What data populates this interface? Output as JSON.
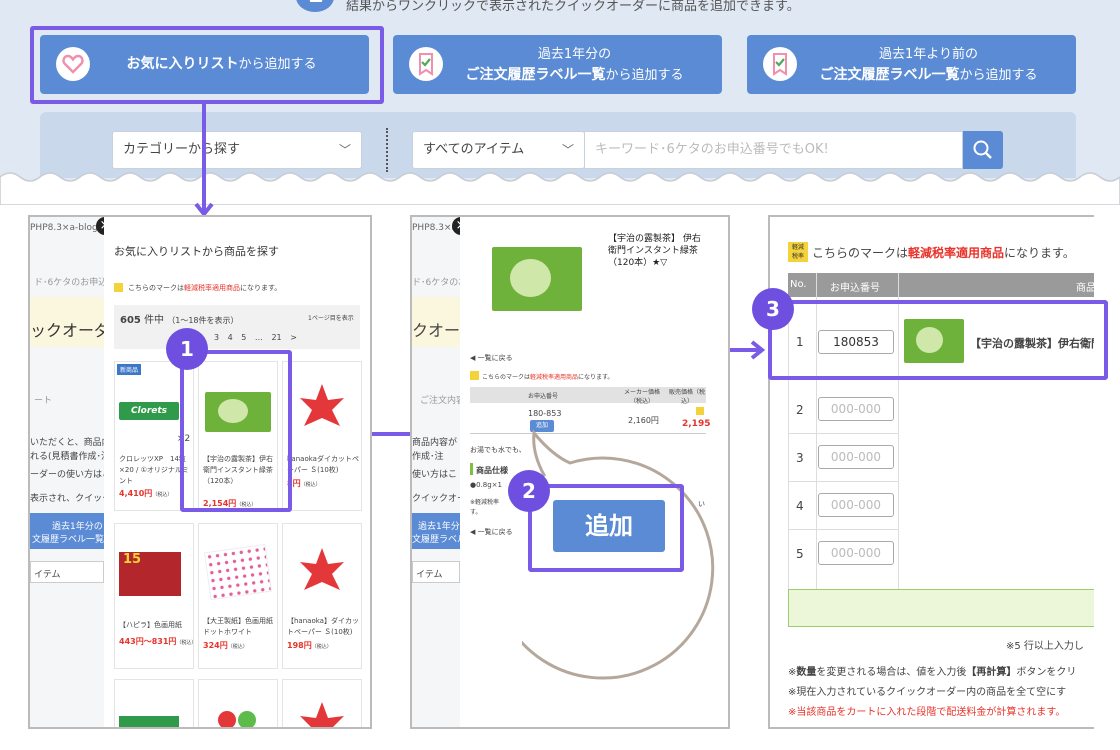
{
  "header": {
    "note": "結果からワンクリックで表示されたクイックオーダーに商品を追加できます。"
  },
  "buttons": [
    {
      "strong": "お気に入りリスト",
      "rest": "から追加する"
    },
    {
      "line1": "過去1年分の",
      "strong": "ご注文履歴ラベル一覧",
      "rest": "から追加する"
    },
    {
      "line1": "過去1年より前の",
      "strong": "ご注文履歴ラベル一覧",
      "rest": "から追加する"
    }
  ],
  "search": {
    "category": "カテゴリーから探す",
    "items": "すべてのアイテム",
    "placeholder": "キーワード･6ケタのお申込番号でもOK!"
  },
  "panel1": {
    "topbar": "PHP8.3×a-blog.",
    "title": "お気に入りリストから商品を探す",
    "tax_note_pre": "こちらのマークは",
    "tax_note_red": "軽減税率適用商品",
    "tax_note_post": "になります。",
    "count": "605",
    "count_unit": "件中",
    "range": "（1～18件を表示）",
    "per_page": "1ページ目を表示",
    "pages": [
      "3",
      "4",
      "5",
      "…",
      "21",
      ">"
    ],
    "bg": {
      "order": "ックオーダ",
      "l1": "ド･6ケタのお申込番号",
      "l2": "いただくと、商品内容が",
      "l3": "れる(見積書作成･注文",
      "l4": "ーダーの使い方はこち",
      "l5": "表示され、クイックオー",
      "btn1": "過去1年分の",
      "btn2": "文履歴ラベル一覧から",
      "sel": "イテム",
      "cart": "ート",
      "hist": "ご注文内容",
      "new": "新商品"
    },
    "products": [
      {
        "name": "クロレッツXP　14粒×20 / ①オリジナルミント",
        "price": "4,410円",
        "tax": "（税込）",
        "qty": "×2"
      },
      {
        "name": "【宇治の露製茶】伊右衛門インスタント緑茶（120本）",
        "price": "2,154円",
        "tax": "（税込）"
      },
      {
        "name": "hanaokaダイカットペーパー Ｓ(10枚)",
        "price": "8円",
        "tax": "（税込）"
      },
      {
        "name": "【ハピラ】色画用紙",
        "price": "443円～831円",
        "tax": "（税込）"
      },
      {
        "name": "【大王製紙】色画用紙 ドットホワイト",
        "price": "324円",
        "tax": "（税込）"
      },
      {
        "name": "【hanaoka】ダイカットペーパー Ｓ(10枚)",
        "price": "198円",
        "tax": "（税込）"
      }
    ],
    "logo": "Clorets",
    "box15": "15"
  },
  "panel2": {
    "topbar": "PHP8.3×a-blog.",
    "title": "【宇治の露製茶】 伊右衛門インスタント緑茶（120本）★▽",
    "back": "一覧に戻る",
    "tax_note_pre": "こちらのマークは",
    "tax_note_red": "軽減税率適用商品",
    "tax_note_post": "になります。",
    "th": [
      "お申込番号",
      "メーカー価格（税込）",
      "販売価格（税込）"
    ],
    "code": "180-853",
    "maker": "2,160円",
    "sale": "2,195",
    "add_small": "追加",
    "desc": "お湯でも水でも、",
    "spec": "商品仕様",
    "spec1": "●0.8g×1",
    "spec2": "※軽減税率",
    "spec3": "す。",
    "back2": "一覧に戻る",
    "add_big": "追加",
    "bg": {
      "l1": "ド･6ケタのお申込番号",
      "l2": "商品内容が",
      "l3": "作成･注",
      "l4": "使い方はこ",
      "l5": "クイックオー",
      "btn1": "過去1年分の",
      "btn2": "文履歴ラベル一覧",
      "sel": "イテム",
      "hist": "ご注文内容",
      "order": "クオーダ"
    }
  },
  "panel3": {
    "tax_note_pre": "こちらのマークは",
    "tax_note_red": "軽減税率適用商品",
    "tax_note_post": "になります。",
    "th": [
      "No.",
      "お申込番号",
      "商品"
    ],
    "rows": [
      {
        "no": "1",
        "code": "180853",
        "product": "【宇治の露製茶】伊右衛門"
      },
      {
        "no": "2",
        "code": "000-000"
      },
      {
        "no": "3",
        "code": "000-000"
      },
      {
        "no": "4",
        "code": "000-000"
      },
      {
        "no": "5",
        "code": "000-000"
      }
    ],
    "more_rows": "※5 行以上入力し",
    "notes": [
      {
        "pre": "※",
        "bold": "数量",
        "mid": "を変更される場合は、値を入力後",
        "bold2": "【再計算】",
        "post": "ボタンをクリ"
      },
      {
        "pre": "※現在入力されているクイックオーダー内の商品を全て空にす"
      },
      {
        "pre": "※当該商品をカートに入れた段階で配送料金が計算されます。"
      }
    ]
  },
  "badge": {
    "l1": "軽減",
    "l2": "税率"
  },
  "steps": [
    "1",
    "2",
    "3"
  ],
  "colors": {
    "accent": "#5b8bd4",
    "highlight": "#7a5be8",
    "price": "#e8332a",
    "tax_badge": "#f3d23a",
    "band": "#dfe8f3"
  }
}
